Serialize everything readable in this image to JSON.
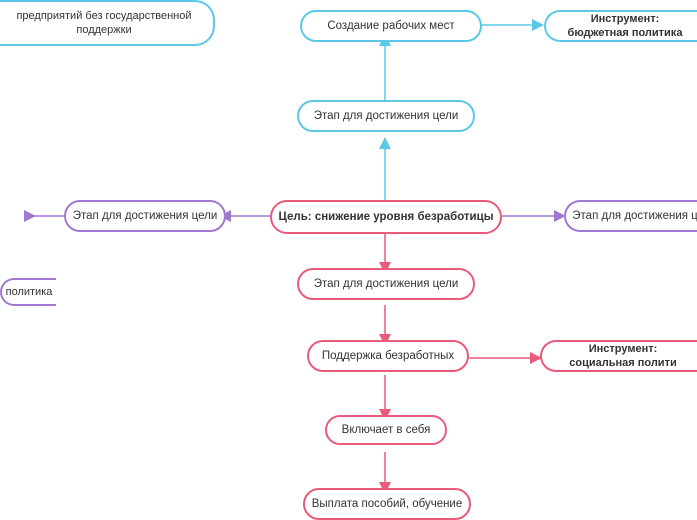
{
  "nodes": {
    "create_jobs": {
      "label": "Создание рабочих мест"
    },
    "instrument_budget": {
      "label": "Инструмент: бюджетная политика"
    },
    "stage_top": {
      "label": "Этап для достижения цели"
    },
    "goal_center": {
      "label": "Цель: снижение уровня безработицы"
    },
    "stage_left": {
      "label": "Этап для достижения цели"
    },
    "stage_right": {
      "label": "Этап для достижения ц"
    },
    "stage_below_goal": {
      "label": "Этап для достижения цели"
    },
    "support_unemployed": {
      "label": "Поддержка безработных"
    },
    "instrument_social": {
      "label": "Инструмент: социальная полити"
    },
    "includes": {
      "label": "Включает в себя"
    },
    "benefits": {
      "label": "Выплата пособий, обучение"
    },
    "enterprises": {
      "label": "предприятий без государственной\nподдержки"
    },
    "politics_left": {
      "label": "политика"
    }
  }
}
